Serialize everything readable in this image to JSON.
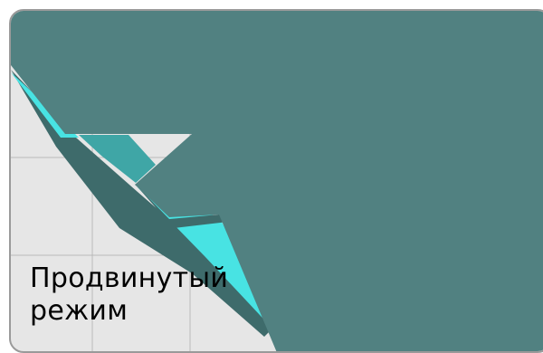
{
  "tile": {
    "label_line1": "Продвинутый",
    "label_line2": "режим"
  },
  "colors": {
    "tile_background": "#e6e6e6",
    "grid_line": "#b9b9b9",
    "shape_main": "#518181",
    "shape_dark": "#3e6b6b",
    "shape_highlight": "#48e3e3",
    "shape_mid": "#3fa6a6",
    "border": "#9a9a9a"
  },
  "icon": "abstract-folded-shape-icon"
}
